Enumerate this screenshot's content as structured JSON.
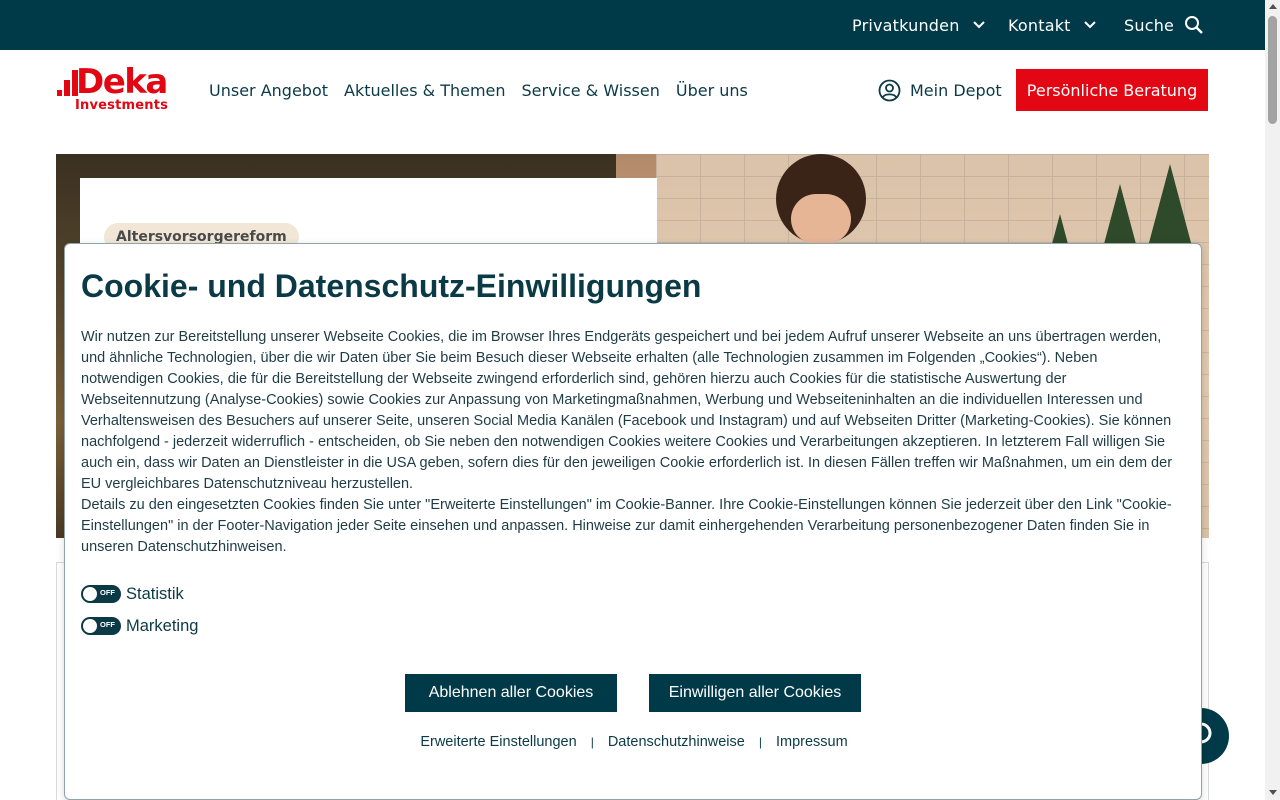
{
  "topbar": {
    "privatkunden": "Privatkunden",
    "kontakt": "Kontakt",
    "suche": "Suche"
  },
  "header": {
    "logo_word": "Deka",
    "logo_sub": "Investments",
    "nav": [
      "Unser Angebot",
      "Aktuelles & Themen",
      "Service & Wissen",
      "Über uns"
    ],
    "depot": "Mein Depot",
    "consult": "Persönliche Beratung"
  },
  "hero": {
    "tag": "Altersvorsorgereform"
  },
  "cookie": {
    "title": "Cookie- und Datenschutz-Einwilligungen",
    "paragraph1": "Wir nutzen zur Bereitstellung unserer Webseite Cookies, die im Browser Ihres Endgeräts gespeichert und bei jedem Aufruf unserer Webseite an uns übertragen werden, und ähnliche Technologien, über die wir Daten über Sie beim Besuch dieser Webseite erhalten (alle Technologien zusammen im Folgenden „Cookies“). Neben notwendigen Cookies, die für die Bereitstellung der Webseite zwingend erforderlich sind, gehören hierzu auch Cookies für die statistische Auswertung der Webseitennutzung (Analyse-Cookies) sowie Cookies zur Anpassung von Marketingmaßnahmen, Werbung und Webseiteninhalten an die individuellen Interessen und Verhaltensweisen des Besuchers auf unserer Seite, unseren Social Media Kanälen (Facebook und Instagram) und auf Webseiten Dritter (Marketing-Cookies). Sie können nachfolgend - jederzeit widerruflich - entscheiden, ob Sie neben den notwendigen Cookies weitere Cookies und Verarbeitungen akzeptieren. In letzterem Fall willigen Sie auch ein, dass wir Daten an Dienstleister in die USA geben, sofern dies für den jeweiligen Cookie erforderlich ist. In diesen Fällen treffen wir Maßnahmen, um ein dem der EU vergleichbares Datenschutzniveau herzustellen.",
    "paragraph2": "Details zu den eingesetzten Cookies finden Sie unter \"Erweiterte Einstellungen\" im Cookie-Banner. Ihre Cookie-Einstellungen können Sie jederzeit über den Link \"Cookie-Einstellungen\" in der Footer-Navigation jeder Seite einsehen und anpassen. Hinweise zur damit einhergehenden Verarbeitung personenbezogener Daten finden Sie in unseren Datenschutzhinweisen.",
    "toggles": [
      {
        "label": "Statistik",
        "state": "OFF"
      },
      {
        "label": "Marketing",
        "state": "OFF"
      }
    ],
    "reject_all": "Ablehnen aller Cookies",
    "accept_all": "Einwilligen aller Cookies",
    "links": [
      "Erweiterte Einstellungen",
      "Datenschutzhinweise",
      "Impressum"
    ],
    "separator": "|"
  },
  "colors": {
    "brand_red": "#e30613",
    "dark_teal": "#003a48"
  }
}
